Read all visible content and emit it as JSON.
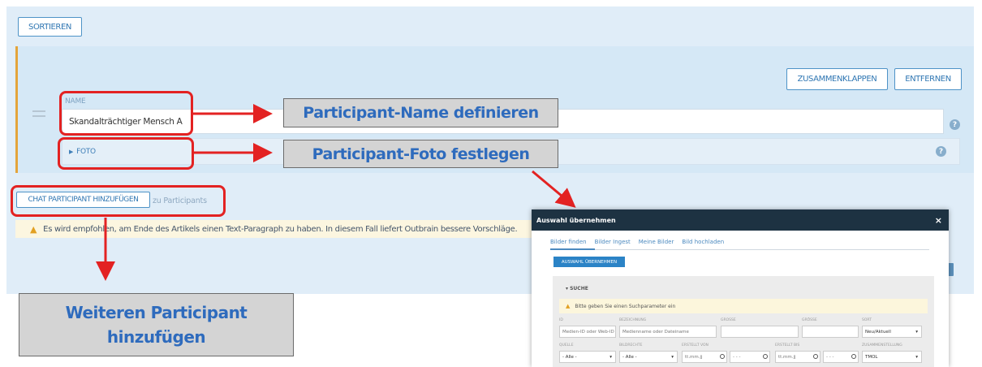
{
  "toolbar": {
    "sort_label": "SORTIEREN"
  },
  "participant": {
    "collapse_label": "ZUSAMMENKLAPPEN",
    "remove_label": "ENTFERNEN",
    "name_label": "NAME",
    "name_value": "Skandalträchtiger Mensch A",
    "foto_label": "FOTO"
  },
  "add_participant": {
    "button_label": "CHAT PARTICIPANT HINZUFÜGEN",
    "suffix": "zu Participants"
  },
  "warning": {
    "text": "Es wird empfohlen, am Ende des Artikels einen Text-Paragraph zu haben. In diesem Fall liefert Outbrain bessere Vorschläge."
  },
  "callouts": {
    "name": "Participant-Name definieren",
    "foto": "Participant-Foto festlegen",
    "add": "Weiteren Participant hinzufügen"
  },
  "modal": {
    "title": "Auswahl übernehmen",
    "close": "×",
    "tabs": [
      "Bilder finden",
      "Bilder Ingest",
      "Meine Bilder",
      "Bild hochladen"
    ],
    "apply_label": "AUSWAHL ÜBERNEHMEN",
    "search_label": "▾ SUCHE",
    "search_warning": "Bitte geben Sie einen Suchparameter ein",
    "fields": {
      "id_placeholder": "Medien-ID oder Web-ID",
      "name_placeholder": "Medienname oder Dateiname",
      "sort_value": "Neu/Aktuell",
      "all_1": "- Alle -",
      "all_2": "- Alle -",
      "date_1": "tt.mm.jj",
      "date_2": "tt.mm.jj",
      "date_sep_1": "- - -",
      "date_sep_2": "- - -",
      "tz_value": "TMOL"
    },
    "labels": {
      "l1": "ID",
      "l2": "BEZEICHNUNG",
      "l3": "GROSSE",
      "l4": "GRÖSSE",
      "l5": "SORT",
      "l6": "QUELLE",
      "l7": "BILDRECHTE",
      "l8": "ERSTELLT VON",
      "l9": "ERSTELLT BIS",
      "l10": "ZUSAMMENSTELLUNG"
    }
  },
  "colors": {
    "red": "#e32222",
    "accent": "#3077b3",
    "modal_header": "#1d3242",
    "callout_text": "#2e6bbd"
  },
  "icons": {
    "warning": "warning-icon",
    "help": "help-icon",
    "drag": "drag-handle-icon",
    "calendar": "calendar-icon"
  }
}
